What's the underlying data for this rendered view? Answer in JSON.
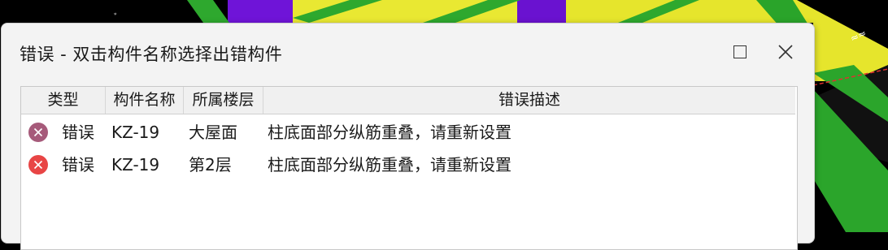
{
  "colors": {
    "error_icon_first": "#a65a7a",
    "error_icon_second": "#e84545"
  },
  "dialog": {
    "title": "错误 - 双击构件名称选择出错构件",
    "max_icon": "maximize-icon",
    "close_icon": "close-icon"
  },
  "table": {
    "headers": [
      "类型",
      "构件名称",
      "所属楼层",
      "错误描述"
    ],
    "rows": [
      {
        "icon": "error-icon",
        "type": "错误",
        "name": "KZ-19",
        "floor": "大屋面",
        "desc": "柱底面部分纵筋重叠，请重新设置"
      },
      {
        "icon": "error-icon",
        "type": "错误",
        "name": "KZ-19",
        "floor": "第2层",
        "desc": "柱底面部分纵筋重叠，请重新设置"
      }
    ]
  }
}
